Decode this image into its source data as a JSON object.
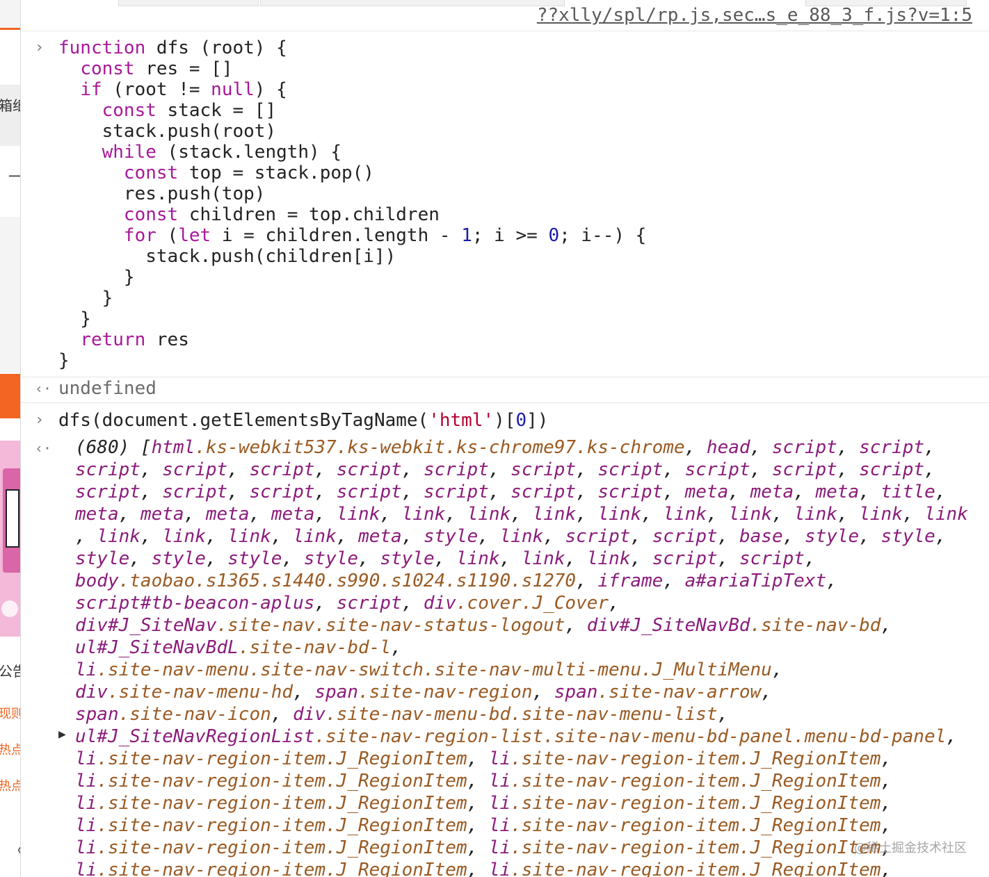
{
  "colors": {
    "keyword": "#a8189a",
    "number": "#1a1aa6",
    "string": "#b5002e",
    "element_tag": "#8b1c7b",
    "element_class": "#9a5a22",
    "left_strip_accent": "#f26522"
  },
  "left_strip": {
    "texts": [
      "箱纸",
      "一",
      "公告",
      "现则",
      "热点",
      "热点",
      "〈"
    ]
  },
  "source_link": "??xlly/spl/rp.js,sec…s_e_88_3_f.js?v=1:5",
  "entry1": {
    "prompt_icon": "chevron-right-icon",
    "code_lines": [
      [
        {
          "t": "kw",
          "v": "function"
        },
        {
          "t": "txt",
          "v": " dfs (root) {"
        }
      ],
      [
        {
          "t": "txt",
          "v": "  "
        },
        {
          "t": "kw",
          "v": "const"
        },
        {
          "t": "txt",
          "v": " res = []"
        }
      ],
      [
        {
          "t": "txt",
          "v": "  "
        },
        {
          "t": "kw",
          "v": "if"
        },
        {
          "t": "txt",
          "v": " (root != "
        },
        {
          "t": "kw",
          "v": "null"
        },
        {
          "t": "txt",
          "v": ") {"
        }
      ],
      [
        {
          "t": "txt",
          "v": "    "
        },
        {
          "t": "kw",
          "v": "const"
        },
        {
          "t": "txt",
          "v": " stack = []"
        }
      ],
      [
        {
          "t": "txt",
          "v": "    stack.push(root)"
        }
      ],
      [
        {
          "t": "txt",
          "v": "    "
        },
        {
          "t": "kw",
          "v": "while"
        },
        {
          "t": "txt",
          "v": " (stack.length) {"
        }
      ],
      [
        {
          "t": "txt",
          "v": "      "
        },
        {
          "t": "kw",
          "v": "const"
        },
        {
          "t": "txt",
          "v": " top = stack.pop()"
        }
      ],
      [
        {
          "t": "txt",
          "v": "      res.push(top)"
        }
      ],
      [
        {
          "t": "txt",
          "v": "      "
        },
        {
          "t": "kw",
          "v": "const"
        },
        {
          "t": "txt",
          "v": " children = top.children"
        }
      ],
      [
        {
          "t": "txt",
          "v": "      "
        },
        {
          "t": "kw",
          "v": "for"
        },
        {
          "t": "txt",
          "v": " ("
        },
        {
          "t": "kw",
          "v": "let"
        },
        {
          "t": "txt",
          "v": " i = children.length - "
        },
        {
          "t": "num",
          "v": "1"
        },
        {
          "t": "txt",
          "v": "; i >= "
        },
        {
          "t": "num",
          "v": "0"
        },
        {
          "t": "txt",
          "v": "; i--) {"
        }
      ],
      [
        {
          "t": "txt",
          "v": "        stack.push(children[i])"
        }
      ],
      [
        {
          "t": "txt",
          "v": "      }"
        }
      ],
      [
        {
          "t": "txt",
          "v": "    }"
        }
      ],
      [
        {
          "t": "txt",
          "v": "  }"
        }
      ],
      [
        {
          "t": "txt",
          "v": "  "
        },
        {
          "t": "kw",
          "v": "return"
        },
        {
          "t": "txt",
          "v": " res"
        }
      ],
      [
        {
          "t": "txt",
          "v": "}"
        }
      ]
    ]
  },
  "entry2": {
    "result_icon": "return-arrow-icon",
    "result_text": "undefined"
  },
  "entry3": {
    "prompt_icon": "chevron-right-icon",
    "code_lines": [
      [
        {
          "t": "txt",
          "v": "dfs(document.getElementsByTagName("
        },
        {
          "t": "str",
          "v": "'html'"
        },
        {
          "t": "txt",
          "v": ")["
        },
        {
          "t": "num",
          "v": "0"
        },
        {
          "t": "txt",
          "v": "])"
        }
      ]
    ]
  },
  "entry4": {
    "result_icon": "return-arrow-icon",
    "expand_icon": "expand-triangle-icon",
    "lines": [
      [
        {
          "t": "p",
          "v": "(680) ["
        },
        {
          "t": "tag",
          "v": "html"
        },
        {
          "t": "cls",
          "v": ".ks-webkit537.ks-webkit.ks-chrome97.ks-chrome"
        },
        {
          "t": "p",
          "v": ", "
        },
        {
          "t": "tag",
          "v": "head"
        },
        {
          "t": "p",
          "v": ", "
        },
        {
          "t": "tag",
          "v": "script"
        },
        {
          "t": "p",
          "v": ", "
        },
        {
          "t": "tag",
          "v": "script"
        },
        {
          "t": "p",
          "v": ","
        }
      ],
      [
        {
          "t": "tag",
          "v": "script"
        },
        {
          "t": "p",
          "v": ", "
        },
        {
          "t": "tag",
          "v": "script"
        },
        {
          "t": "p",
          "v": ", "
        },
        {
          "t": "tag",
          "v": "script"
        },
        {
          "t": "p",
          "v": ", "
        },
        {
          "t": "tag",
          "v": "script"
        },
        {
          "t": "p",
          "v": ", "
        },
        {
          "t": "tag",
          "v": "script"
        },
        {
          "t": "p",
          "v": ", "
        },
        {
          "t": "tag",
          "v": "script"
        },
        {
          "t": "p",
          "v": ", "
        },
        {
          "t": "tag",
          "v": "script"
        },
        {
          "t": "p",
          "v": ", "
        },
        {
          "t": "tag",
          "v": "script"
        },
        {
          "t": "p",
          "v": ", "
        },
        {
          "t": "tag",
          "v": "script"
        },
        {
          "t": "p",
          "v": ", "
        },
        {
          "t": "tag",
          "v": "script"
        },
        {
          "t": "p",
          "v": ","
        }
      ],
      [
        {
          "t": "tag",
          "v": "script"
        },
        {
          "t": "p",
          "v": ", "
        },
        {
          "t": "tag",
          "v": "script"
        },
        {
          "t": "p",
          "v": ", "
        },
        {
          "t": "tag",
          "v": "script"
        },
        {
          "t": "p",
          "v": ", "
        },
        {
          "t": "tag",
          "v": "script"
        },
        {
          "t": "p",
          "v": ", "
        },
        {
          "t": "tag",
          "v": "script"
        },
        {
          "t": "p",
          "v": ", "
        },
        {
          "t": "tag",
          "v": "script"
        },
        {
          "t": "p",
          "v": ", "
        },
        {
          "t": "tag",
          "v": "script"
        },
        {
          "t": "p",
          "v": ", "
        },
        {
          "t": "tag",
          "v": "meta"
        },
        {
          "t": "p",
          "v": ", "
        },
        {
          "t": "tag",
          "v": "meta"
        },
        {
          "t": "p",
          "v": ", "
        },
        {
          "t": "tag",
          "v": "meta"
        },
        {
          "t": "p",
          "v": ", "
        },
        {
          "t": "tag",
          "v": "title"
        },
        {
          "t": "p",
          "v": ","
        }
      ],
      [
        {
          "t": "tag",
          "v": "meta"
        },
        {
          "t": "p",
          "v": ", "
        },
        {
          "t": "tag",
          "v": "meta"
        },
        {
          "t": "p",
          "v": ", "
        },
        {
          "t": "tag",
          "v": "meta"
        },
        {
          "t": "p",
          "v": ", "
        },
        {
          "t": "tag",
          "v": "meta"
        },
        {
          "t": "p",
          "v": ", "
        },
        {
          "t": "tag",
          "v": "link"
        },
        {
          "t": "p",
          "v": ", "
        },
        {
          "t": "tag",
          "v": "link"
        },
        {
          "t": "p",
          "v": ", "
        },
        {
          "t": "tag",
          "v": "link"
        },
        {
          "t": "p",
          "v": ", "
        },
        {
          "t": "tag",
          "v": "link"
        },
        {
          "t": "p",
          "v": ", "
        },
        {
          "t": "tag",
          "v": "link"
        },
        {
          "t": "p",
          "v": ", "
        },
        {
          "t": "tag",
          "v": "link"
        },
        {
          "t": "p",
          "v": ", "
        },
        {
          "t": "tag",
          "v": "link"
        },
        {
          "t": "p",
          "v": ", "
        },
        {
          "t": "tag",
          "v": "link"
        },
        {
          "t": "p",
          "v": ", "
        },
        {
          "t": "tag",
          "v": "link"
        },
        {
          "t": "p",
          "v": ", "
        },
        {
          "t": "tag",
          "v": "link"
        }
      ],
      [
        {
          "t": "p",
          "v": ", "
        },
        {
          "t": "tag",
          "v": "link"
        },
        {
          "t": "p",
          "v": ", "
        },
        {
          "t": "tag",
          "v": "link"
        },
        {
          "t": "p",
          "v": ", "
        },
        {
          "t": "tag",
          "v": "link"
        },
        {
          "t": "p",
          "v": ", "
        },
        {
          "t": "tag",
          "v": "link"
        },
        {
          "t": "p",
          "v": ", "
        },
        {
          "t": "tag",
          "v": "meta"
        },
        {
          "t": "p",
          "v": ", "
        },
        {
          "t": "tag",
          "v": "style"
        },
        {
          "t": "p",
          "v": ", "
        },
        {
          "t": "tag",
          "v": "link"
        },
        {
          "t": "p",
          "v": ", "
        },
        {
          "t": "tag",
          "v": "script"
        },
        {
          "t": "p",
          "v": ", "
        },
        {
          "t": "tag",
          "v": "script"
        },
        {
          "t": "p",
          "v": ", "
        },
        {
          "t": "tag",
          "v": "base"
        },
        {
          "t": "p",
          "v": ", "
        },
        {
          "t": "tag",
          "v": "style"
        },
        {
          "t": "p",
          "v": ", "
        },
        {
          "t": "tag",
          "v": "style"
        },
        {
          "t": "p",
          "v": ","
        }
      ],
      [
        {
          "t": "tag",
          "v": "style"
        },
        {
          "t": "p",
          "v": ", "
        },
        {
          "t": "tag",
          "v": "style"
        },
        {
          "t": "p",
          "v": ", "
        },
        {
          "t": "tag",
          "v": "style"
        },
        {
          "t": "p",
          "v": ", "
        },
        {
          "t": "tag",
          "v": "style"
        },
        {
          "t": "p",
          "v": ", "
        },
        {
          "t": "tag",
          "v": "style"
        },
        {
          "t": "p",
          "v": ", "
        },
        {
          "t": "tag",
          "v": "link"
        },
        {
          "t": "p",
          "v": ", "
        },
        {
          "t": "tag",
          "v": "link"
        },
        {
          "t": "p",
          "v": ", "
        },
        {
          "t": "tag",
          "v": "link"
        },
        {
          "t": "p",
          "v": ", "
        },
        {
          "t": "tag",
          "v": "script"
        },
        {
          "t": "p",
          "v": ", "
        },
        {
          "t": "tag",
          "v": "script"
        },
        {
          "t": "p",
          "v": ","
        }
      ],
      [
        {
          "t": "tag",
          "v": "body"
        },
        {
          "t": "cls",
          "v": ".taobao.s1365.s1440.s990.s1024.s1190.s1270"
        },
        {
          "t": "p",
          "v": ", "
        },
        {
          "t": "tag",
          "v": "iframe"
        },
        {
          "t": "p",
          "v": ", "
        },
        {
          "t": "tag",
          "v": "a#ariaTipText"
        },
        {
          "t": "p",
          "v": ","
        }
      ],
      [
        {
          "t": "tag",
          "v": "script#tb-beacon-aplus"
        },
        {
          "t": "p",
          "v": ", "
        },
        {
          "t": "tag",
          "v": "script"
        },
        {
          "t": "p",
          "v": ", "
        },
        {
          "t": "tag",
          "v": "div"
        },
        {
          "t": "cls",
          "v": ".cover.J_Cover"
        },
        {
          "t": "p",
          "v": ","
        }
      ],
      [
        {
          "t": "tag",
          "v": "div#J_SiteNav"
        },
        {
          "t": "cls",
          "v": ".site-nav.site-nav-status-logout"
        },
        {
          "t": "p",
          "v": ", "
        },
        {
          "t": "tag",
          "v": "div#J_SiteNavBd"
        },
        {
          "t": "cls",
          "v": ".site-nav-bd"
        },
        {
          "t": "p",
          "v": ","
        }
      ],
      [
        {
          "t": "tag",
          "v": "ul#J_SiteNavBdL"
        },
        {
          "t": "cls",
          "v": ".site-nav-bd-l"
        },
        {
          "t": "p",
          "v": ","
        }
      ],
      [
        {
          "t": "tag",
          "v": "li"
        },
        {
          "t": "cls",
          "v": ".site-nav-menu.site-nav-switch.site-nav-multi-menu.J_MultiMenu"
        },
        {
          "t": "p",
          "v": ","
        }
      ],
      [
        {
          "t": "tag",
          "v": "div"
        },
        {
          "t": "cls",
          "v": ".site-nav-menu-hd"
        },
        {
          "t": "p",
          "v": ", "
        },
        {
          "t": "tag",
          "v": "span"
        },
        {
          "t": "cls",
          "v": ".site-nav-region"
        },
        {
          "t": "p",
          "v": ", "
        },
        {
          "t": "tag",
          "v": "span"
        },
        {
          "t": "cls",
          "v": ".site-nav-arrow"
        },
        {
          "t": "p",
          "v": ","
        }
      ],
      [
        {
          "t": "tag",
          "v": "span"
        },
        {
          "t": "cls",
          "v": ".site-nav-icon"
        },
        {
          "t": "p",
          "v": ", "
        },
        {
          "t": "tag",
          "v": "div"
        },
        {
          "t": "cls",
          "v": ".site-nav-menu-bd.site-nav-menu-list"
        },
        {
          "t": "p",
          "v": ","
        }
      ],
      [
        {
          "t": "tag",
          "v": "ul#J_SiteNavRegionList"
        },
        {
          "t": "cls",
          "v": ".site-nav-region-list.site-nav-menu-bd-panel.menu-bd-panel"
        },
        {
          "t": "p",
          "v": ","
        }
      ],
      [
        {
          "t": "tag",
          "v": "li"
        },
        {
          "t": "cls",
          "v": ".site-nav-region-item.J_RegionItem"
        },
        {
          "t": "p",
          "v": ", "
        },
        {
          "t": "tag",
          "v": "li"
        },
        {
          "t": "cls",
          "v": ".site-nav-region-item.J_RegionItem"
        },
        {
          "t": "p",
          "v": ","
        }
      ],
      [
        {
          "t": "tag",
          "v": "li"
        },
        {
          "t": "cls",
          "v": ".site-nav-region-item.J_RegionItem"
        },
        {
          "t": "p",
          "v": ", "
        },
        {
          "t": "tag",
          "v": "li"
        },
        {
          "t": "cls",
          "v": ".site-nav-region-item.J_RegionItem"
        },
        {
          "t": "p",
          "v": ","
        }
      ],
      [
        {
          "t": "tag",
          "v": "li"
        },
        {
          "t": "cls",
          "v": ".site-nav-region-item.J_RegionItem"
        },
        {
          "t": "p",
          "v": ", "
        },
        {
          "t": "tag",
          "v": "li"
        },
        {
          "t": "cls",
          "v": ".site-nav-region-item.J_RegionItem"
        },
        {
          "t": "p",
          "v": ","
        }
      ],
      [
        {
          "t": "tag",
          "v": "li"
        },
        {
          "t": "cls",
          "v": ".site-nav-region-item.J_RegionItem"
        },
        {
          "t": "p",
          "v": ", "
        },
        {
          "t": "tag",
          "v": "li"
        },
        {
          "t": "cls",
          "v": ".site-nav-region-item.J_RegionItem"
        },
        {
          "t": "p",
          "v": ","
        }
      ],
      [
        {
          "t": "tag",
          "v": "li"
        },
        {
          "t": "cls",
          "v": ".site-nav-region-item.J_RegionItem"
        },
        {
          "t": "p",
          "v": ", "
        },
        {
          "t": "tag",
          "v": "li"
        },
        {
          "t": "cls",
          "v": ".site-nav-region-item.J_RegionItem"
        },
        {
          "t": "p",
          "v": ","
        }
      ],
      [
        {
          "t": "tag",
          "v": "li"
        },
        {
          "t": "cls",
          "v": ".site-nav-region-item.J_RegionItem"
        },
        {
          "t": "p",
          "v": ", "
        },
        {
          "t": "tag",
          "v": "li"
        },
        {
          "t": "cls",
          "v": ".site-nav-region-item.J_RegionItem"
        },
        {
          "t": "p",
          "v": ","
        }
      ]
    ]
  },
  "watermark": "@稀土掘金技术社区"
}
